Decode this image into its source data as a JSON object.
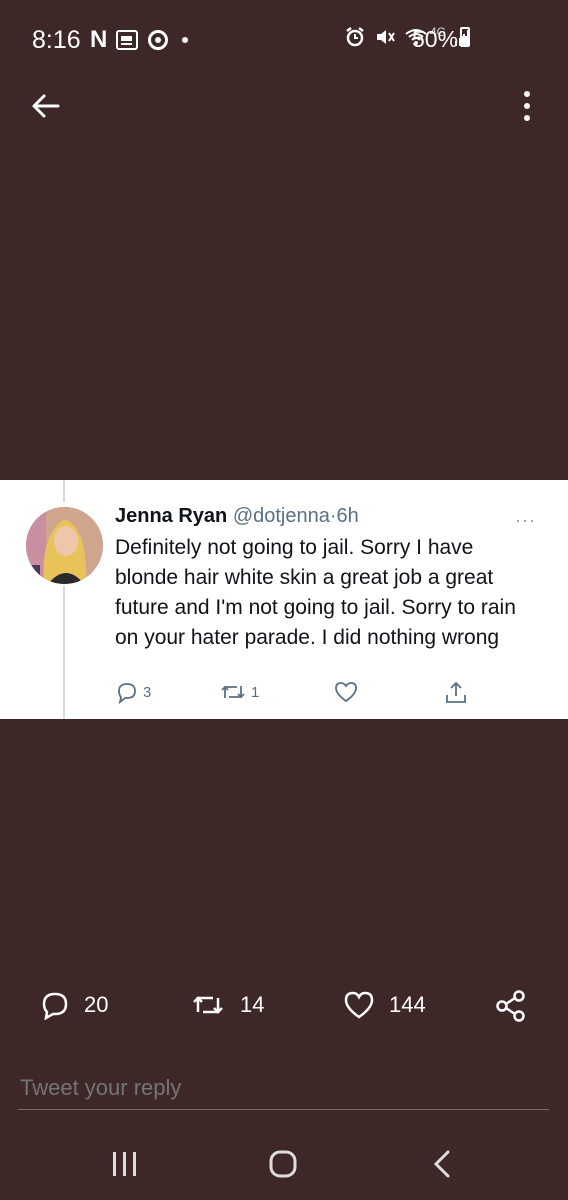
{
  "status_bar": {
    "time": "8:16",
    "netflix_letter": "N",
    "network": "4G",
    "battery": "50%"
  },
  "tweet": {
    "name": "Jenna Ryan",
    "handle": "@dotjenna",
    "separator": "·",
    "age": "6h",
    "more": "···",
    "text": "Definitely not going to jail. Sorry I have blonde hair white skin a great job a great future and I'm not going to jail. Sorry to rain on your hater parade. I did nothing wrong",
    "reply_count": "3",
    "retweet_count": "1"
  },
  "stats": {
    "replies": "20",
    "retweets": "14",
    "likes": "144"
  },
  "reply": {
    "placeholder": "Tweet your reply"
  },
  "colors": {
    "background": "#3e2727",
    "card": "#ffffff"
  }
}
